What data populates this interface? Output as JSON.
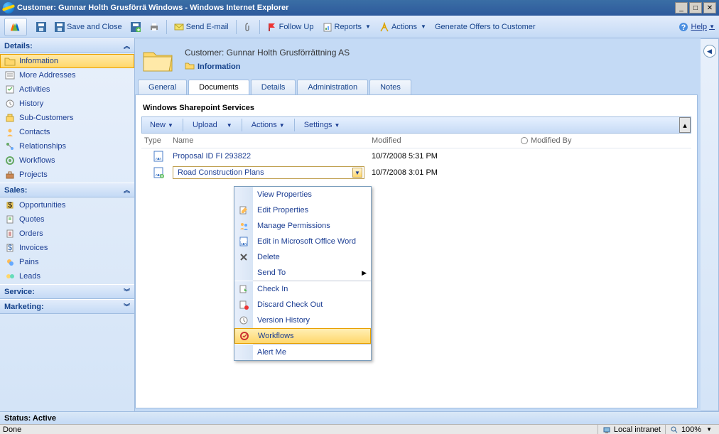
{
  "titlebar": {
    "text": "Customer: Gunnar Holth Grusförrä Windows  - Windows Internet Explorer"
  },
  "toolbar": {
    "save_close": "Save and Close",
    "send_email": "Send E-mail",
    "follow_up": "Follow Up",
    "reports": "Reports",
    "actions": "Actions",
    "generate_offers": "Generate Offers to Customer",
    "help": "Help"
  },
  "header": {
    "customer": "Customer: Gunnar Holth Grusförrättning AS",
    "title": "Information"
  },
  "nav": {
    "details": {
      "label": "Details:",
      "items": [
        "Information",
        "More Addresses",
        "Activities",
        "History",
        "Sub-Customers",
        "Contacts",
        "Relationships",
        "Workflows",
        "Projects"
      ]
    },
    "sales": {
      "label": "Sales:",
      "items": [
        "Opportunities",
        "Quotes",
        "Orders",
        "Invoices",
        "Pains",
        "Leads"
      ]
    },
    "service": {
      "label": "Service:"
    },
    "marketing": {
      "label": "Marketing:"
    }
  },
  "tabs": [
    "General",
    "Documents",
    "Details",
    "Administration",
    "Notes"
  ],
  "sharepoint": {
    "title": "Windows Sharepoint Services",
    "tb": {
      "new": "New",
      "upload": "Upload",
      "actions": "Actions",
      "settings": "Settings"
    },
    "cols": {
      "type": "Type",
      "name": "Name",
      "modified": "Modified",
      "modified_by": "Modified By"
    },
    "rows": [
      {
        "name": "Proposal ID FI 293822",
        "modified": "10/7/2008 5:31 PM"
      },
      {
        "name": "Road Construction Plans",
        "modified": "10/7/2008 3:01 PM"
      }
    ]
  },
  "ctx": {
    "items": [
      "View Properties",
      "Edit Properties",
      "Manage Permissions",
      "Edit in Microsoft Office Word",
      "Delete",
      "Send To",
      "Check In",
      "Discard Check Out",
      "Version History",
      "Workflows",
      "Alert Me"
    ]
  },
  "status": {
    "s1": "Status: Active",
    "s2_left": "Done",
    "s2_zone": "Local intranet",
    "s2_zoom": "100%"
  }
}
